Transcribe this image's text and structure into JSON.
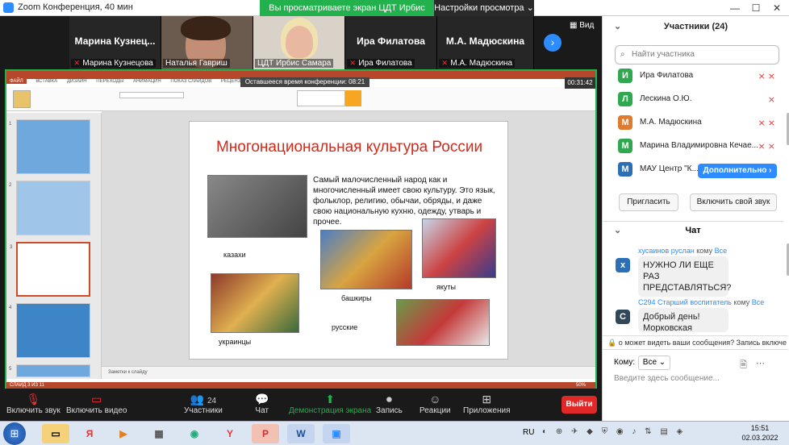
{
  "window": {
    "title": "Zoom Конференция, 40 мин",
    "minimize": "—",
    "maximize": "☐",
    "close": "✕"
  },
  "share_banner": {
    "text": "Вы просматриваете экран ЦДТ Ирбис Самара",
    "view_options": "Настройки просмотра ⌄"
  },
  "video_tiles": [
    {
      "display_name": "Марина  Кузнец...",
      "label": "Марина Кузнецова",
      "muted": true
    },
    {
      "display_name": "",
      "label": "Наталья Гавриш",
      "muted": false
    },
    {
      "display_name": "",
      "label": "ЦДТ Ирбис Самара",
      "muted": false
    },
    {
      "display_name": "Ира Филатова",
      "label": "Ира Филатова",
      "muted": true
    },
    {
      "display_name": "М.А. Мадюскина",
      "label": "М.А. Мадюскина",
      "muted": true
    }
  ],
  "view_label": "Вид",
  "powerpoint": {
    "timer_banner": "Оставшееся время конференции: 08:21",
    "timer_right": "00:31:42",
    "tabs": [
      "ФАЙЛ",
      "ВСТАВКА",
      "ДИЗАЙН",
      "ПЕРЕХОДЫ",
      "АНИМАЦИЯ",
      "ПОКАЗ СЛАЙДОВ",
      "РЕЦЕНЗИРОВАНИЕ"
    ],
    "notes_placeholder": "Заметки к слайду",
    "status_left": "СЛАЙД 3 ИЗ 11",
    "status_zoom": "50%",
    "thumb_numbers": [
      "1",
      "2",
      "3",
      "4",
      "5"
    ],
    "slide": {
      "title": "Многонациональная культура России",
      "body": "Самый малочисленный народ как и многочисленный имеет свою культуру. Это язык, фольклор, религию, обычаи, обряды, и даже свою национальную кухню, одежду, утварь и прочее.",
      "captions": {
        "kazakhs": "казахи",
        "bashkirs": "башкиры",
        "yakuts": "якуты",
        "russians": "русские",
        "ukrainians": "украинцы"
      }
    }
  },
  "toolbar": {
    "unmute": "Включить звук",
    "video": "Включить видео",
    "participants": "Участники",
    "participants_count": "24",
    "chat": "Чат",
    "share": "Демонстрация экрана",
    "record": "Запись",
    "reactions": "Реакции",
    "apps": "Приложения",
    "leave": "Выйти"
  },
  "participants_panel": {
    "title": "Участники (24)",
    "search_placeholder": "Найти участника",
    "rows": [
      {
        "initial": "И",
        "name": "Ира Филатова",
        "color": "#2fa84f"
      },
      {
        "initial": "Л",
        "name": "Лескина О.Ю.",
        "color": "#2fa84f"
      },
      {
        "initial": "М",
        "name": "М.А. Мадюскина",
        "color": "#e07a2e"
      },
      {
        "initial": "М",
        "name": "Марина Владимировна Кечае...",
        "color": "#2fa84f"
      },
      {
        "initial": "М",
        "name": "МАУ Центр \"К...",
        "color": "#2d6fb7"
      }
    ],
    "more_button": "Дополнительно ›",
    "invite": "Пригласить",
    "unmute_self": "Включить свой звук"
  },
  "chat_panel": {
    "title": "Чат",
    "messages": [
      {
        "avatar": "х",
        "from": "хусаинов руслан",
        "to_word": "кому",
        "to": "Все",
        "text": "НУЖНО ЛИ ЕЩЕ РАЗ ПРЕДСТАВЛЯТЬСЯ?",
        "color": "#2d6fb7"
      },
      {
        "avatar": "С",
        "from": "С294 Старший воспитатель",
        "to_word": "кому",
        "to": "Все",
        "text": "Добрый день! Морковская",
        "color": "#33475b"
      }
    ],
    "notice": "о может видеть ваши сообщения? Запись включе",
    "to_label": "Кому:",
    "to_value": "Все ⌄",
    "input_placeholder": "Введите здесь сообщение..."
  },
  "taskbar": {
    "lang": "RU",
    "time": "15:51",
    "date": "02.03.2022"
  }
}
